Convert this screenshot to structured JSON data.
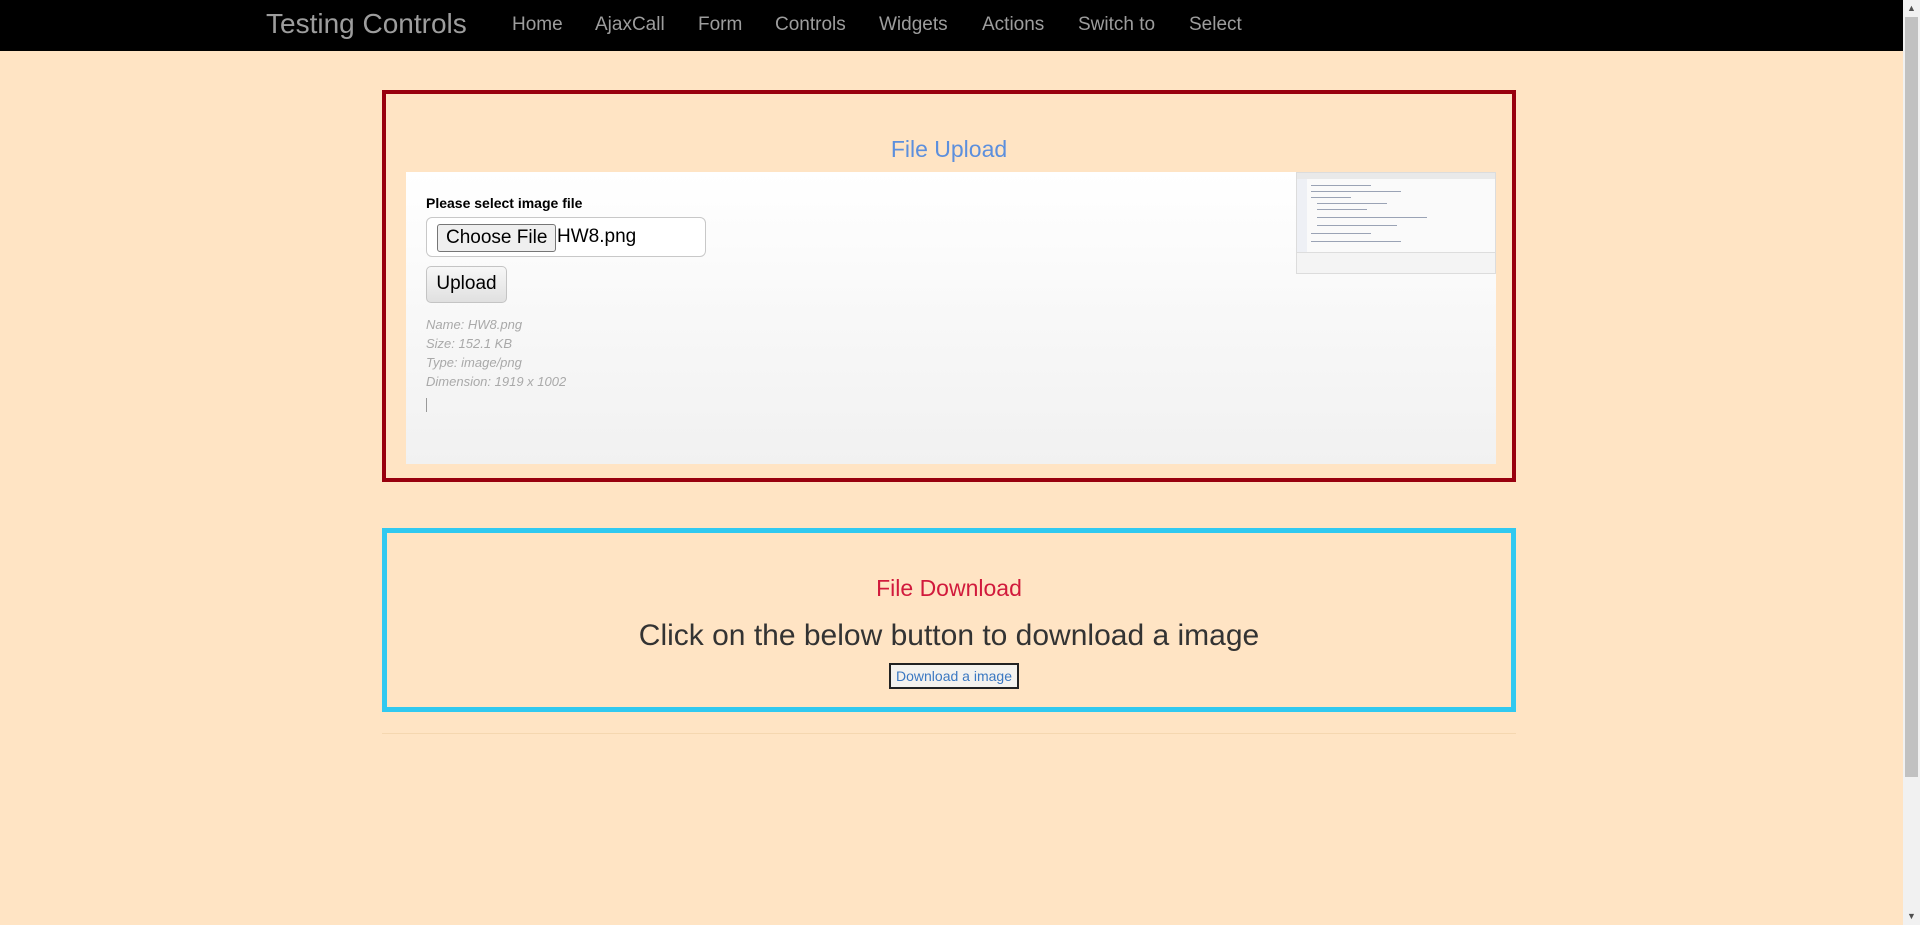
{
  "nav": {
    "brand": "Testing Controls",
    "items": [
      "Home",
      "AjaxCall",
      "Form",
      "Controls",
      "Widgets",
      "Actions",
      "Switch to",
      "Select"
    ]
  },
  "upload": {
    "title": "File Upload",
    "label": "Please select image file",
    "choose_button": "Choose File",
    "file_name": "HW8.png",
    "upload_button": "Upload",
    "meta": {
      "name": "Name: HW8.png",
      "size": "Size: 152.1 KB",
      "type": "Type: image/png",
      "dimension": "Dimension: 1919 x 1002"
    }
  },
  "download": {
    "title": "File Download",
    "text": "Click on the below button to download a image",
    "button": "Download a image"
  },
  "colors": {
    "background": "#ffe4c4",
    "navbar": "#000000",
    "upload_border": "#98000e",
    "upload_title": "#5c8fdd",
    "download_border": "#31c9f0",
    "download_title": "#d11a3c"
  }
}
